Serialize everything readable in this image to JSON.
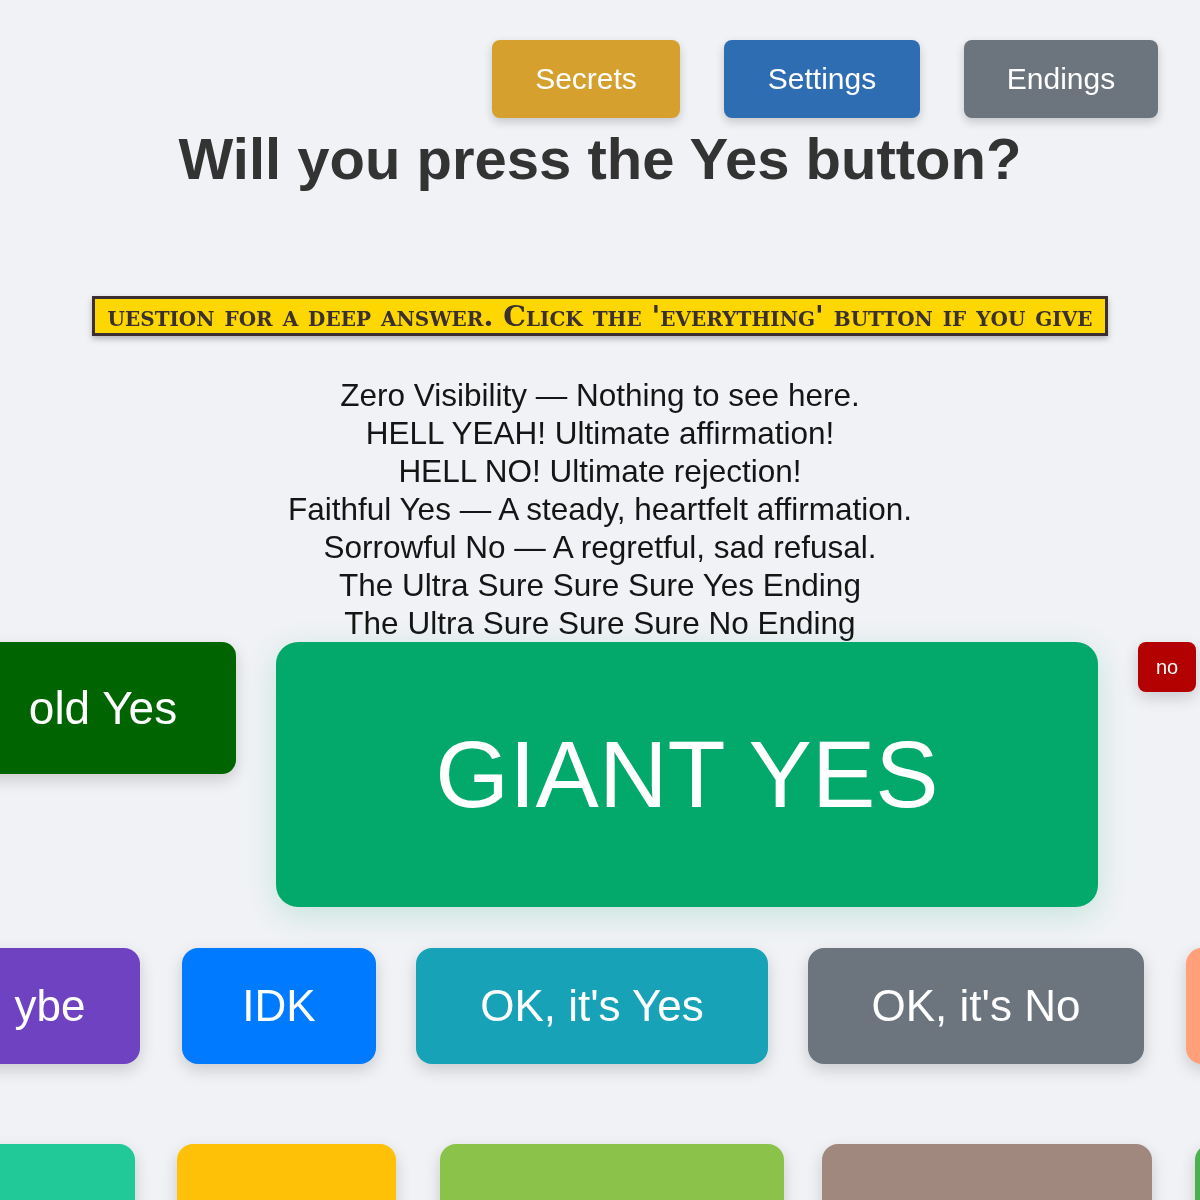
{
  "top_buttons": [
    {
      "label": "Secrets",
      "color": "#d6a02e"
    },
    {
      "label": "Settings",
      "color": "#2f6db3"
    },
    {
      "label": "Endings",
      "color": "#6c757d"
    }
  ],
  "title": "Will you press the Yes button?",
  "banner": {
    "text": "uestion for a deep answer. Click the 'everything' button if you give"
  },
  "endings": [
    "Zero Visibility — Nothing to see here.",
    "HELL YEAH! Ultimate affirmation!",
    "HELL NO! Ultimate rejection!",
    "Faithful Yes — A steady, heartfelt affirmation.",
    "Sorrowful No — A regretful, sad refusal.",
    "The Ultra Sure Sure Sure Yes Ending",
    "The Ultra Sure Sure Sure No Ending"
  ],
  "rows": [
    {
      "buttons": [
        {
          "label": "old Yes",
          "kind": "large",
          "color": "#006400"
        },
        {
          "label": "GIANT YES",
          "kind": "giant",
          "color": "#03a86b"
        },
        {
          "label": "no",
          "kind": "tiny",
          "color": "#b30000"
        }
      ]
    },
    {
      "buttons": [
        {
          "label": "ybe",
          "kind": "normal",
          "color": "#6f42c1"
        },
        {
          "label": "IDK",
          "kind": "normal",
          "color": "#007bff"
        },
        {
          "label": "OK, it's Yes",
          "kind": "normal",
          "color": "#17a2b8"
        },
        {
          "label": "OK, it's No",
          "kind": "normal",
          "color": "#6c757d"
        },
        {
          "kind": "normal",
          "color": "#ffa07a"
        }
      ]
    },
    {
      "buttons": [
        {
          "kind": "normal",
          "color": "#20c997"
        },
        {
          "kind": "normal",
          "color": "#ffc107"
        },
        {
          "kind": "normal",
          "color": "#8bc34a"
        },
        {
          "kind": "normal",
          "color": "#a1887f"
        },
        {
          "kind": "normal",
          "color": "#4caf50"
        }
      ]
    }
  ]
}
